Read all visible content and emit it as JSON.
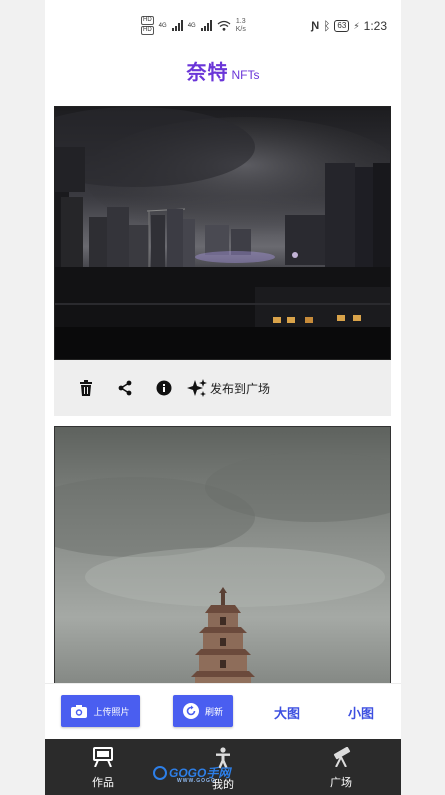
{
  "status_bar": {
    "speed": "1.3",
    "speed_unit": "K/s",
    "net_left": "4G",
    "net_right": "4G",
    "battery": "63",
    "time": "1:23"
  },
  "header": {
    "title_cn": "奈特",
    "title_en": "NFTs"
  },
  "card": {
    "publish_label": "发布到广场",
    "icons": [
      "trash-icon",
      "share-icon",
      "info-icon",
      "sparkle-icon"
    ]
  },
  "toolbar": {
    "upload_label": "上传照片",
    "refresh_label": "刷新",
    "large_label": "大图",
    "small_label": "小图",
    "accent": "#4a5ef0"
  },
  "nav": {
    "items": [
      {
        "label": "作品",
        "icon": "easel-icon"
      },
      {
        "label": "我的",
        "icon": "person-icon"
      },
      {
        "label": "广场",
        "icon": "telescope-icon"
      }
    ]
  },
  "watermark": {
    "text": "GOGO手网",
    "sub": "WWW.GOGO"
  },
  "colors": {
    "title": "#6a35d8",
    "nav_bg": "#2b2b2b"
  }
}
